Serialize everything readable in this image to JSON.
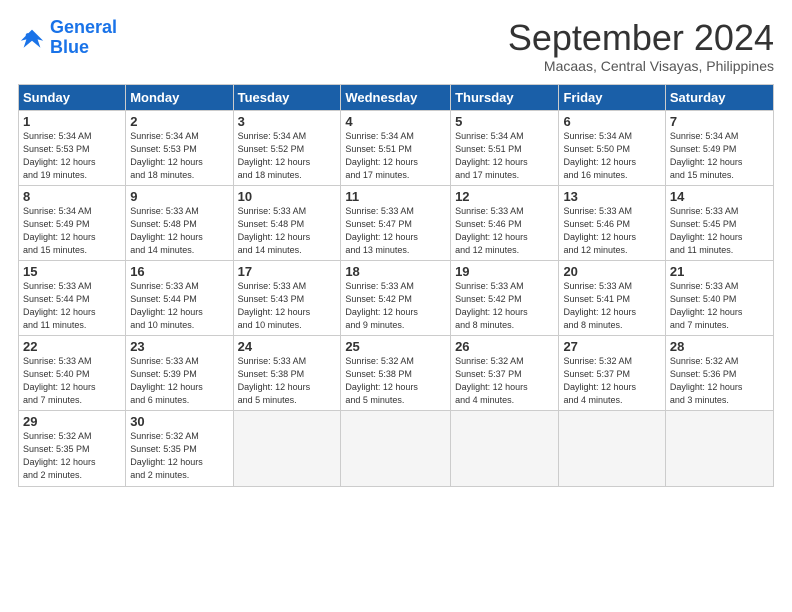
{
  "logo": {
    "line1": "General",
    "line2": "Blue"
  },
  "title": "September 2024",
  "location": "Macaas, Central Visayas, Philippines",
  "headers": [
    "Sunday",
    "Monday",
    "Tuesday",
    "Wednesday",
    "Thursday",
    "Friday",
    "Saturday"
  ],
  "weeks": [
    [
      {
        "day": "1",
        "info": "Sunrise: 5:34 AM\nSunset: 5:53 PM\nDaylight: 12 hours\nand 19 minutes."
      },
      {
        "day": "2",
        "info": "Sunrise: 5:34 AM\nSunset: 5:53 PM\nDaylight: 12 hours\nand 18 minutes."
      },
      {
        "day": "3",
        "info": "Sunrise: 5:34 AM\nSunset: 5:52 PM\nDaylight: 12 hours\nand 18 minutes."
      },
      {
        "day": "4",
        "info": "Sunrise: 5:34 AM\nSunset: 5:51 PM\nDaylight: 12 hours\nand 17 minutes."
      },
      {
        "day": "5",
        "info": "Sunrise: 5:34 AM\nSunset: 5:51 PM\nDaylight: 12 hours\nand 17 minutes."
      },
      {
        "day": "6",
        "info": "Sunrise: 5:34 AM\nSunset: 5:50 PM\nDaylight: 12 hours\nand 16 minutes."
      },
      {
        "day": "7",
        "info": "Sunrise: 5:34 AM\nSunset: 5:49 PM\nDaylight: 12 hours\nand 15 minutes."
      }
    ],
    [
      {
        "day": "8",
        "info": "Sunrise: 5:34 AM\nSunset: 5:49 PM\nDaylight: 12 hours\nand 15 minutes."
      },
      {
        "day": "9",
        "info": "Sunrise: 5:33 AM\nSunset: 5:48 PM\nDaylight: 12 hours\nand 14 minutes."
      },
      {
        "day": "10",
        "info": "Sunrise: 5:33 AM\nSunset: 5:48 PM\nDaylight: 12 hours\nand 14 minutes."
      },
      {
        "day": "11",
        "info": "Sunrise: 5:33 AM\nSunset: 5:47 PM\nDaylight: 12 hours\nand 13 minutes."
      },
      {
        "day": "12",
        "info": "Sunrise: 5:33 AM\nSunset: 5:46 PM\nDaylight: 12 hours\nand 12 minutes."
      },
      {
        "day": "13",
        "info": "Sunrise: 5:33 AM\nSunset: 5:46 PM\nDaylight: 12 hours\nand 12 minutes."
      },
      {
        "day": "14",
        "info": "Sunrise: 5:33 AM\nSunset: 5:45 PM\nDaylight: 12 hours\nand 11 minutes."
      }
    ],
    [
      {
        "day": "15",
        "info": "Sunrise: 5:33 AM\nSunset: 5:44 PM\nDaylight: 12 hours\nand 11 minutes."
      },
      {
        "day": "16",
        "info": "Sunrise: 5:33 AM\nSunset: 5:44 PM\nDaylight: 12 hours\nand 10 minutes."
      },
      {
        "day": "17",
        "info": "Sunrise: 5:33 AM\nSunset: 5:43 PM\nDaylight: 12 hours\nand 10 minutes."
      },
      {
        "day": "18",
        "info": "Sunrise: 5:33 AM\nSunset: 5:42 PM\nDaylight: 12 hours\nand 9 minutes."
      },
      {
        "day": "19",
        "info": "Sunrise: 5:33 AM\nSunset: 5:42 PM\nDaylight: 12 hours\nand 8 minutes."
      },
      {
        "day": "20",
        "info": "Sunrise: 5:33 AM\nSunset: 5:41 PM\nDaylight: 12 hours\nand 8 minutes."
      },
      {
        "day": "21",
        "info": "Sunrise: 5:33 AM\nSunset: 5:40 PM\nDaylight: 12 hours\nand 7 minutes."
      }
    ],
    [
      {
        "day": "22",
        "info": "Sunrise: 5:33 AM\nSunset: 5:40 PM\nDaylight: 12 hours\nand 7 minutes."
      },
      {
        "day": "23",
        "info": "Sunrise: 5:33 AM\nSunset: 5:39 PM\nDaylight: 12 hours\nand 6 minutes."
      },
      {
        "day": "24",
        "info": "Sunrise: 5:33 AM\nSunset: 5:38 PM\nDaylight: 12 hours\nand 5 minutes."
      },
      {
        "day": "25",
        "info": "Sunrise: 5:32 AM\nSunset: 5:38 PM\nDaylight: 12 hours\nand 5 minutes."
      },
      {
        "day": "26",
        "info": "Sunrise: 5:32 AM\nSunset: 5:37 PM\nDaylight: 12 hours\nand 4 minutes."
      },
      {
        "day": "27",
        "info": "Sunrise: 5:32 AM\nSunset: 5:37 PM\nDaylight: 12 hours\nand 4 minutes."
      },
      {
        "day": "28",
        "info": "Sunrise: 5:32 AM\nSunset: 5:36 PM\nDaylight: 12 hours\nand 3 minutes."
      }
    ],
    [
      {
        "day": "29",
        "info": "Sunrise: 5:32 AM\nSunset: 5:35 PM\nDaylight: 12 hours\nand 2 minutes."
      },
      {
        "day": "30",
        "info": "Sunrise: 5:32 AM\nSunset: 5:35 PM\nDaylight: 12 hours\nand 2 minutes."
      },
      null,
      null,
      null,
      null,
      null
    ]
  ]
}
